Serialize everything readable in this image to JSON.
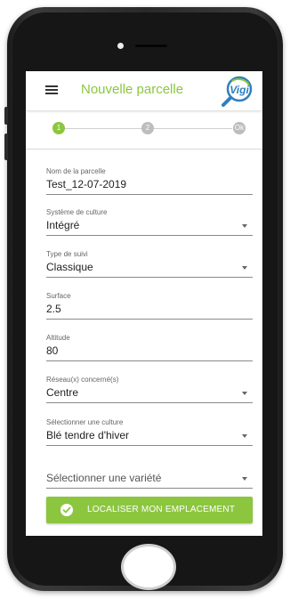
{
  "app": {
    "title": "Nouvelle parcelle",
    "logo_text": "Vigi",
    "accent_color": "#8cc63f"
  },
  "stepper": {
    "steps": [
      {
        "label": "1",
        "state": "active"
      },
      {
        "label": "2",
        "state": "inactive"
      },
      {
        "label": "Ok",
        "state": "inactive"
      }
    ]
  },
  "form": {
    "parcel_name": {
      "label": "Nom de la parcelle",
      "value": "Test_12-07-2019"
    },
    "cultivation_system": {
      "label": "Système de culture",
      "value": "Intégré"
    },
    "monitoring_type": {
      "label": "Type de suivi",
      "value": "Classique"
    },
    "surface": {
      "label": "Surface",
      "value": "2.5"
    },
    "altitude": {
      "label": "Altitude",
      "value": "80"
    },
    "network": {
      "label": "Réseau(x) concerné(s)",
      "value": "Centre"
    },
    "crop": {
      "label": "Sélectionner une culture",
      "value": "Blé tendre d'hiver"
    },
    "variety": {
      "placeholder": "Sélectionner une variété"
    }
  },
  "actions": {
    "locate_label": "LOCALISER MON EMPLACEMENT"
  },
  "icons": {
    "menu": "hamburger-icon",
    "logo": "magnifier-logo-icon",
    "dropdown": "chevron-down-icon",
    "check": "check-circle-icon"
  }
}
